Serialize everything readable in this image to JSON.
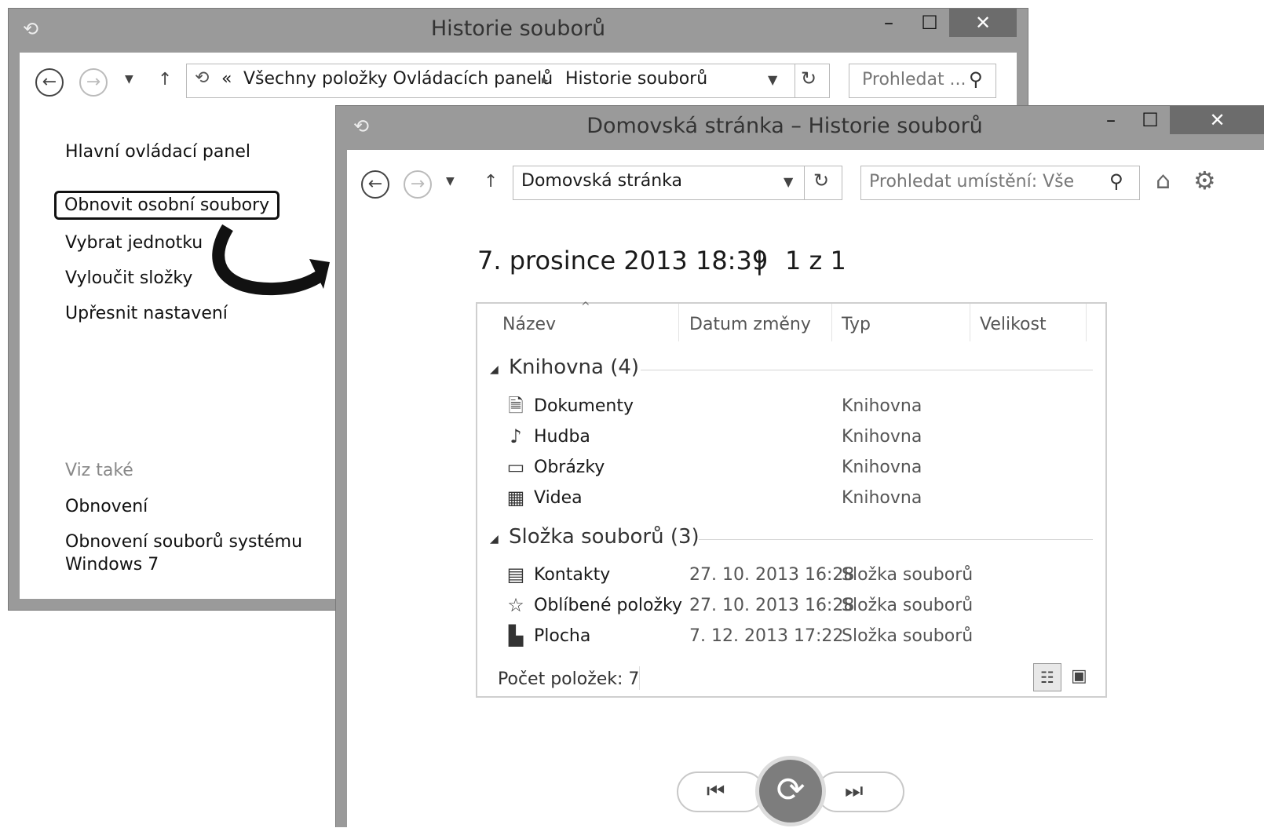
{
  "back_window": {
    "title": "Historie souborů",
    "minimize": "–",
    "maximize": "☐",
    "close": "✕",
    "breadcrumb_prefix": "«",
    "breadcrumb_parent": "Všechny položky Ovládacích panelů",
    "breadcrumb_sep": "▸",
    "breadcrumb_current": "Historie souborů",
    "search_placeholder": "Prohledat ...",
    "sidebar": {
      "home": "Hlavní ovládací panel",
      "links": [
        "Obnovit osobní soubory",
        "Vybrat jednotku",
        "Vyloučit složky",
        "Upřesnit nastavení"
      ],
      "see_also_label": "Viz také",
      "see_also": [
        "Obnovení",
        "Obnovení souborů systému",
        "Windows 7"
      ]
    }
  },
  "front_window": {
    "title": "Domovská stránka – Historie souborů",
    "minimize": "–",
    "maximize": "☐",
    "close": "✕",
    "address": "Domovská stránka",
    "search_placeholder": "Prohledat umístění: Vše",
    "snapshot_date": "7. prosince 2013 18:39",
    "snapshot_sep": "|",
    "snapshot_position": "1 z 1",
    "columns": [
      "Název",
      "Datum změny",
      "Typ",
      "Velikost"
    ],
    "groups": [
      {
        "label": "Knihovna (4)",
        "items": [
          {
            "icon": "document-library-icon",
            "name": "Dokumenty",
            "date": "",
            "type": "Knihovna"
          },
          {
            "icon": "music-library-icon",
            "name": "Hudba",
            "date": "",
            "type": "Knihovna"
          },
          {
            "icon": "pictures-library-icon",
            "name": "Obrázky",
            "date": "",
            "type": "Knihovna"
          },
          {
            "icon": "videos-library-icon",
            "name": "Videa",
            "date": "",
            "type": "Knihovna"
          }
        ]
      },
      {
        "label": "Složka souborů (3)",
        "items": [
          {
            "icon": "contacts-folder-icon",
            "name": "Kontakty",
            "date": "27. 10. 2013 16:28",
            "type": "Složka souborů"
          },
          {
            "icon": "favorites-folder-icon",
            "name": "Oblíbené položky",
            "date": "27. 10. 2013 16:28",
            "type": "Složka souborů"
          },
          {
            "icon": "desktop-folder-icon",
            "name": "Plocha",
            "date": "7. 12. 2013 17:22",
            "type": "Složka souborů"
          }
        ]
      }
    ],
    "status": "Počet položek: 7"
  },
  "colors": {
    "titlebar": "#9a9a9a",
    "close_button": "#6c6c6c",
    "restore_button": "#7d7d7d"
  }
}
